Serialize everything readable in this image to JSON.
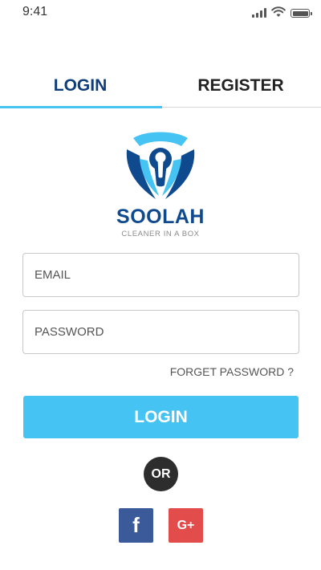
{
  "status_bar": {
    "time": "9:41",
    "icons": [
      "signal-icon",
      "wifi-icon",
      "battery-icon"
    ]
  },
  "tabs": [
    {
      "label": "LOGIN",
      "active": true
    },
    {
      "label": "REGISTER",
      "active": false
    }
  ],
  "brand": {
    "name": "SOOLAH",
    "tagline": "CLEANER IN A BOX"
  },
  "form": {
    "email": {
      "placeholder": "EMAIL",
      "value": ""
    },
    "password": {
      "placeholder": "PASSWORD",
      "value": ""
    },
    "forgot_label": "FORGET PASSWORD ?",
    "submit_label": "LOGIN"
  },
  "divider_label": "OR",
  "social": {
    "facebook_glyph": "f",
    "google_glyph": "G+"
  },
  "colors": {
    "accent": "#45c3f2",
    "brand_navy": "#104a8e",
    "facebook": "#3a5a9a",
    "google": "#e24c4a"
  }
}
